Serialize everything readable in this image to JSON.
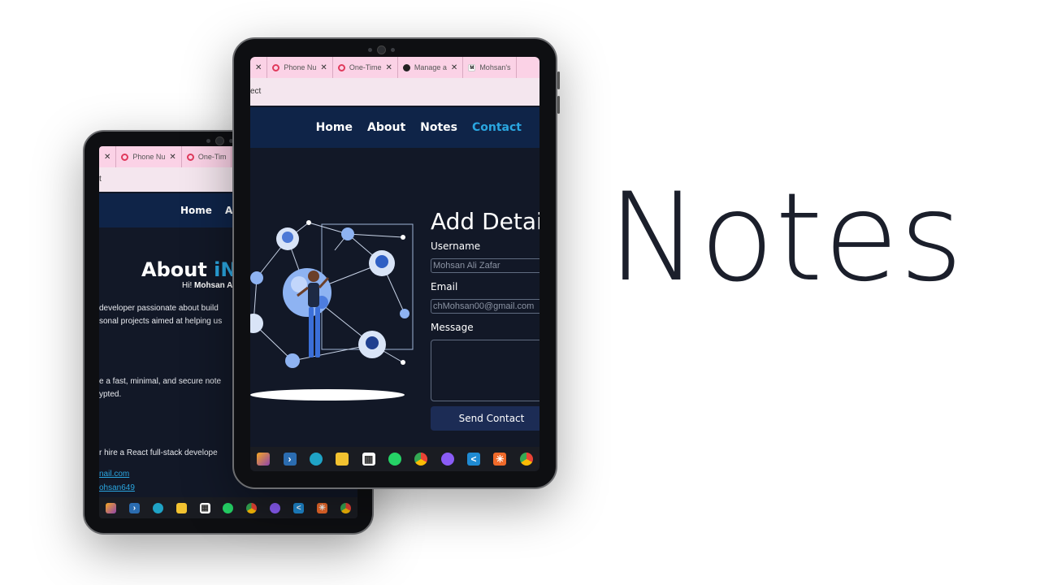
{
  "hero": {
    "title": "Notes"
  },
  "front": {
    "tabs": [
      {
        "label": "",
        "icon": "close-icon"
      },
      {
        "label": "Phone Nu",
        "icon": "globe-icon"
      },
      {
        "label": "One-Time",
        "icon": "globe-icon"
      },
      {
        "label": "Manage a",
        "icon": "github-icon"
      },
      {
        "label": "Mohsan's",
        "icon": "m-logo-icon"
      }
    ],
    "address": "ect",
    "nav": {
      "home": "Home",
      "about": "About",
      "notes": "Notes",
      "contact": "Contact"
    },
    "form": {
      "title": "Add Details",
      "username_label": "Username",
      "username_value": "Mohsan Ali Zafar",
      "email_label": "Email",
      "email_value": "chMohsan00@gmail.com",
      "message_label": "Message",
      "submit": "Send Contact"
    }
  },
  "back": {
    "tabs": [
      {
        "label": "",
        "icon": "close-icon"
      },
      {
        "label": "Phone Nu",
        "icon": "globe-icon"
      },
      {
        "label": "One-Tim",
        "icon": "globe-icon"
      }
    ],
    "address": "t",
    "nav": {
      "home": "Home",
      "about": "Ab"
    },
    "about": {
      "title_plain": "About ",
      "title_highlight": "iNo",
      "hi_prefix": "Hi! ",
      "hi_name": "Mohsan A",
      "para1_line1": "developer passionate about build",
      "para1_line2": "sonal projects aimed at helping us",
      "para2_line1": "e a fast, minimal, and secure note",
      "para2_line2": "ypted.",
      "para3": "r hire a React full-stack develope",
      "email_link": "nail.com",
      "github_link": "ohsan649"
    }
  },
  "taskbar_icons": [
    "copilot-icon",
    "terminal-icon",
    "edge-icon",
    "file-explorer-icon",
    "store-icon",
    "whatsapp-icon",
    "chrome-icon",
    "github-desktop-icon",
    "vscode-icon",
    "app-icon",
    "chrome-icon"
  ],
  "colors": {
    "accent": "#2aa6e0",
    "navbar": "#0f2448",
    "page_bg": "#121827",
    "tab_bg": "#fbd2e6"
  }
}
